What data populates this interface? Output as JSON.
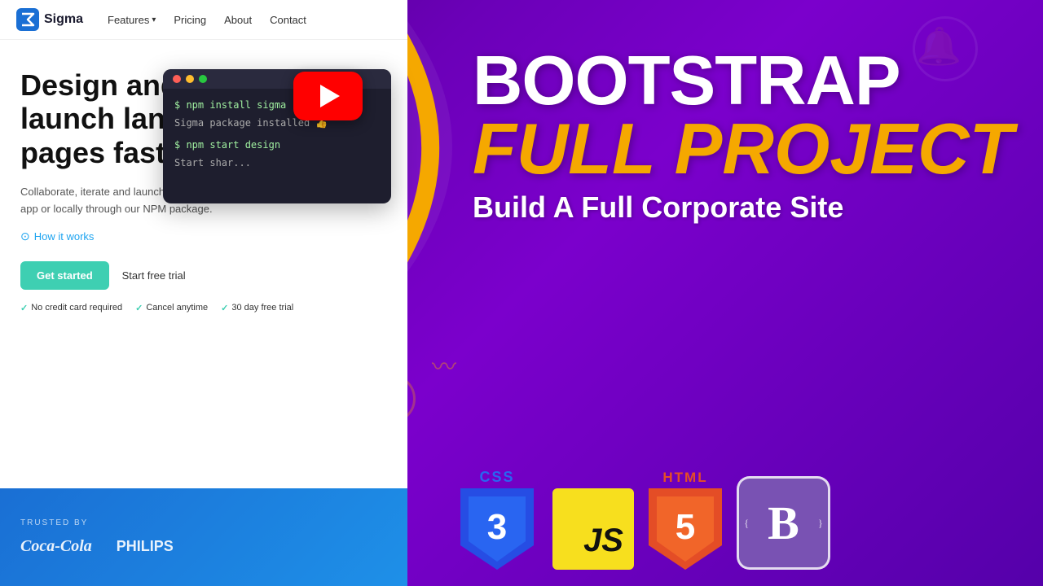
{
  "brand": {
    "logo_text": "Sigma"
  },
  "navbar": {
    "features_label": "Features",
    "pricing_label": "Pricing",
    "about_label": "About",
    "contact_label": "Contact"
  },
  "hero": {
    "title": "Design and launch landing pages faster.",
    "description": "Collaborate, iterate and launch landing pages through our app or locally through our NPM package.",
    "how_it_works": "How it works",
    "cta_button": "Get started",
    "secondary_cta": "Start free trial",
    "badge1": "No credit card required",
    "badge2": "Cancel anytime",
    "badge3": "30 day free trial"
  },
  "terminal": {
    "line1_cmd": "$ npm install sigma",
    "line2_output": "Sigma package installed 👍",
    "line3_cmd": "$ npm start design",
    "line4_output": "Start shar..."
  },
  "trust_bar": {
    "label": "TRUSTED BY",
    "logo1": "Coca-Cola",
    "logo2": "PHILIPS"
  },
  "right_panel": {
    "title1": "BOOTSTRAP",
    "title2": "FULL PROJECT",
    "subtitle": "Build A Full Corporate Site"
  },
  "tech_icons": {
    "css_label": "CSS",
    "css_number": "3",
    "js_label": "JS",
    "html_label": "HTML",
    "html_number": "5",
    "bootstrap_label": "B"
  },
  "colors": {
    "accent_teal": "#3ecfb2",
    "purple_bg": "#6b00b8",
    "youtube_red": "#ff0000",
    "gold": "#f5a800",
    "css_blue": "#2965f1",
    "js_yellow": "#f7df1e",
    "html_orange": "#e44d26",
    "bootstrap_purple": "#7952b3"
  }
}
